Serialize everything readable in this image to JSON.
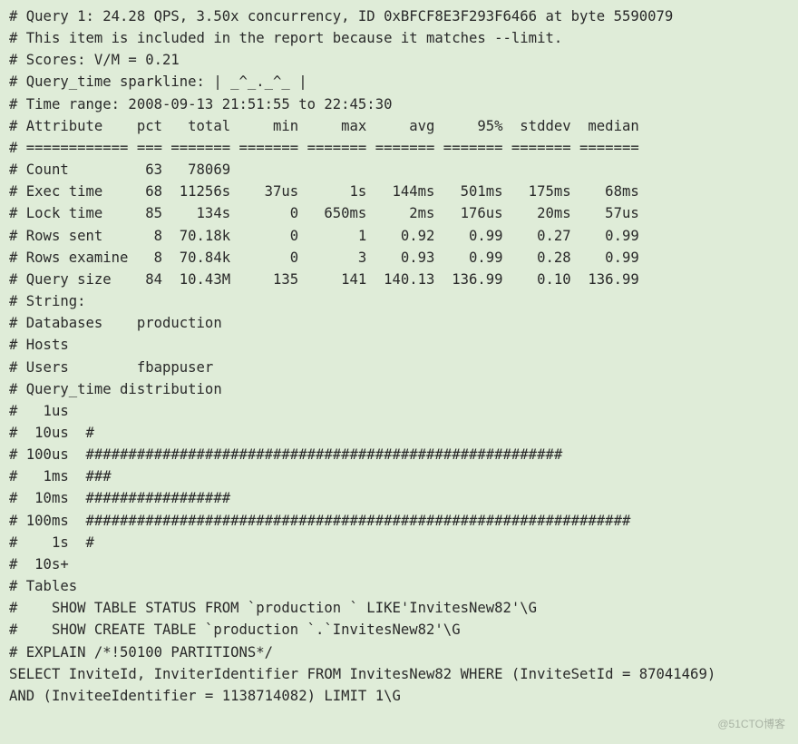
{
  "header": {
    "query_line": "# Query 1: 24.28 QPS, 3.50x concurrency, ID 0xBFCF8E3F293F6466 at byte 5590079",
    "reason": "# This item is included in the report because it matches --limit.",
    "scores": "# Scores: V/M = 0.21",
    "sparkline": "# Query_time sparkline: | _^_._^_ |",
    "time_range": "# Time range: 2008-09-13 21:51:55 to 22:45:30"
  },
  "table": {
    "header_line": "# Attribute    pct   total     min     max     avg     95%  stddev  median",
    "divider_line": "# ============ === ======= ======= ======= ======= ======= ======= =======",
    "rows": {
      "count": "# Count         63   78069",
      "exectime": "# Exec time     68  11256s    37us      1s   144ms   501ms   175ms    68ms",
      "locktime": "# Lock time     85    134s       0   650ms     2ms   176us    20ms    57us",
      "rowssent": "# Rows sent      8  70.18k       0       1    0.92    0.99    0.27    0.99",
      "rowsexamine": "# Rows examine   8  70.84k       0       3    0.93    0.99    0.28    0.99",
      "querysize": "# Query size    84  10.43M     135     141  140.13  136.99    0.10  136.99"
    }
  },
  "strings": {
    "label": "# String:",
    "databases": "# Databases    production",
    "hosts": "# Hosts",
    "users": "# Users        fbappuser"
  },
  "dist": {
    "title": "# Query_time distribution",
    "b1us": "#   1us",
    "b10us": "#  10us  #",
    "b100us": "# 100us  ########################################################",
    "b1ms": "#   1ms  ###",
    "b10ms": "#  10ms  #################",
    "b100ms": "# 100ms  ################################################################",
    "b1s": "#    1s  #",
    "b10s": "#  10s+"
  },
  "tables": {
    "label": "# Tables",
    "status": "#    SHOW TABLE STATUS FROM `production ` LIKE'InvitesNew82'\\G",
    "create": "#    SHOW CREATE TABLE `production `.`InvitesNew82'\\G"
  },
  "sql": {
    "explain": "# EXPLAIN /*!50100 PARTITIONS*/",
    "line1": "SELECT InviteId, InviterIdentifier FROM InvitesNew82 WHERE (InviteSetId = 87041469)",
    "line2": "AND (InviteeIdentifier = 1138714082) LIMIT 1\\G"
  },
  "watermark": "@51CTO博客"
}
